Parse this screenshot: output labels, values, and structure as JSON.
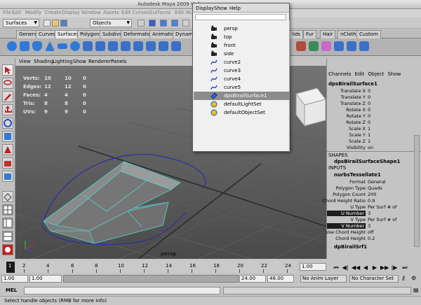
{
  "window": {
    "title": "Autodesk Maya 2009 Unlim"
  },
  "menubar": {
    "items": [
      "File",
      "Edit",
      "Modify",
      "Create",
      "Display",
      "Window",
      "Assets",
      "Edit Curves",
      "Surfaces",
      "Edit NU"
    ]
  },
  "status_line": {
    "mode": "Surfaces",
    "selection_mask": "Objects"
  },
  "shelf_tabs": {
    "items": [
      "General",
      "Curves",
      "Surfaces",
      "Polygons",
      "Subdivs",
      "Deformation",
      "Animation",
      "Dynamic",
      "lids",
      "Fur",
      "Hair",
      "nCloth",
      "Custom"
    ],
    "active": "Surfaces"
  },
  "viewport": {
    "menu": [
      "View",
      "Shading",
      "Lighting",
      "Show",
      "Renderer",
      "Panels"
    ],
    "hud": {
      "labels": [
        "Verts:",
        "Edges:",
        "Faces:",
        "Tris:",
        "UVs:"
      ],
      "col1": [
        "10",
        "12",
        "4",
        "8",
        "9"
      ],
      "col2": [
        "10",
        "12",
        "4",
        "8",
        "9"
      ],
      "col3": [
        "0",
        "0",
        "0",
        "0",
        "0"
      ]
    },
    "camera_label": "persp"
  },
  "outliner": {
    "menu": [
      "Display",
      "Show",
      "Help"
    ],
    "items": [
      {
        "label": "persp",
        "icon": "camera-icon"
      },
      {
        "label": "top",
        "icon": "camera-icon"
      },
      {
        "label": "front",
        "icon": "camera-icon"
      },
      {
        "label": "side",
        "icon": "camera-icon"
      },
      {
        "label": "curve2",
        "icon": "curve-icon"
      },
      {
        "label": "curve3",
        "icon": "curve-icon"
      },
      {
        "label": "curve4",
        "icon": "curve-icon"
      },
      {
        "label": "curve5",
        "icon": "curve-icon"
      },
      {
        "label": "dpsBirailSurface1",
        "icon": "surface-icon",
        "selected": true
      },
      {
        "label": "defaultLightSet",
        "icon": "set-icon"
      },
      {
        "label": "defaultObjectSet",
        "icon": "set-icon"
      }
    ]
  },
  "channel_box": {
    "menu": [
      "Channels",
      "Edit",
      "Object",
      "Show"
    ],
    "object_name": "dpsBirailSurface1",
    "attributes": [
      {
        "k": "Translate X",
        "v": "0"
      },
      {
        "k": "Translate Y",
        "v": "0"
      },
      {
        "k": "Translate Z",
        "v": "0"
      },
      {
        "k": "Rotate X",
        "v": "0"
      },
      {
        "k": "Rotate Y",
        "v": "0"
      },
      {
        "k": "Rotate Z",
        "v": "0"
      },
      {
        "k": "Scale X",
        "v": "1"
      },
      {
        "k": "Scale Y",
        "v": "1"
      },
      {
        "k": "Scale Z",
        "v": "1"
      },
      {
        "k": "Visibility",
        "v": "on"
      }
    ],
    "shapes_header": "SHAPES",
    "shape_name": "dpsBirailSurfaceShape1",
    "inputs_header": "INPUTS",
    "input_name": "nurbsTessellate1",
    "input_attributes": [
      {
        "k": "Format",
        "v": "General"
      },
      {
        "k": "Polygon Type",
        "v": "Quads"
      },
      {
        "k": "Polygon Count",
        "v": "200"
      },
      {
        "k": "Chord Height Ratio",
        "v": "0.9"
      },
      {
        "k": "U Type",
        "v": "Per Surf # of"
      },
      {
        "k": "U Number",
        "v": "3",
        "highlight": true
      },
      {
        "k": "V Type",
        "v": "Per Surf # of"
      },
      {
        "k": "V Number",
        "v": "3",
        "highlight": true
      },
      {
        "k": "Use Chord Height",
        "v": "off"
      },
      {
        "k": "Chord Height",
        "v": "0.2"
      }
    ],
    "footer": "dpBirailSrf1"
  },
  "time_slider": {
    "ticks": [
      "1",
      "2",
      "4",
      "6",
      "8",
      "10",
      "12",
      "14",
      "16",
      "18",
      "20",
      "22",
      "24"
    ],
    "current_frame": "1.00"
  },
  "range_slider": {
    "start": "1.00",
    "inner_start": "1.00",
    "inner_end": "24.00",
    "end": "48.00",
    "anim_layer": "No Anim Layer",
    "character_set": "No Character Set"
  },
  "command_line": {
    "label": "MEL"
  },
  "help_line": {
    "text": "Select handle objects (RMB for more info)"
  },
  "colors": {
    "accent": "#1e1e1e",
    "selection": "#8c8c8c",
    "wire": "#52d0c8",
    "curve": "#3030c8"
  }
}
